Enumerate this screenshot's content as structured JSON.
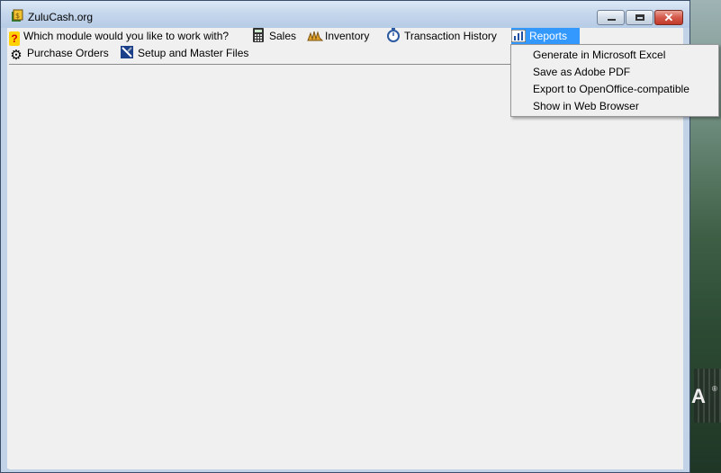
{
  "window": {
    "title": "ZuluCash.org"
  },
  "menu": {
    "question": "Which module would you like to work with?",
    "sales": "Sales",
    "inventory": "Inventory",
    "transaction_history": "Transaction History",
    "reports": "Reports",
    "purchase_orders": "Purchase Orders",
    "setup": "Setup and Master Files"
  },
  "reports_menu": {
    "items": [
      "Generate in Microsoft Excel",
      "Save as Adobe PDF",
      "Export to OpenOffice-compatible",
      "Show in Web Browser"
    ]
  },
  "desktop": {
    "logo_text": "A",
    "registered": "®"
  },
  "icons": {
    "question": "question-icon",
    "sales": "calculator-icon",
    "inventory": "hands-icon",
    "transaction_history": "stopwatch-icon",
    "reports": "chart-icon",
    "purchase_orders": "gear-icon",
    "setup": "setup-icon"
  },
  "colors": {
    "highlight": "#3399ff",
    "titlebar": "#c4d6ec",
    "close": "#c03a2b"
  }
}
